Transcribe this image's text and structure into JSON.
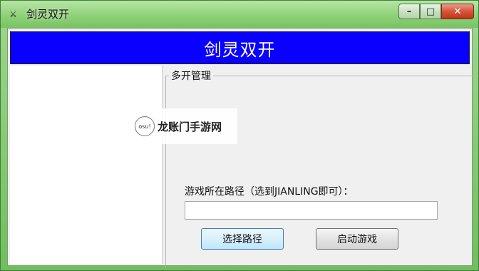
{
  "window": {
    "title": "剑灵双开",
    "icon": "sword-app-icon",
    "controls": {
      "minimize": "–",
      "maximize": "□",
      "close": "✕"
    }
  },
  "banner": {
    "text": "剑灵双开",
    "color": "#0a00ff"
  },
  "group": {
    "title": "多开管理"
  },
  "watermark": {
    "logo": "osu!",
    "text": "龙账门手游网"
  },
  "form": {
    "path_label": "游戏所在路径（选到JIANLING即可）：",
    "path_value": "",
    "select_path_label": "选择路径",
    "start_game_label": "启动游戏"
  }
}
